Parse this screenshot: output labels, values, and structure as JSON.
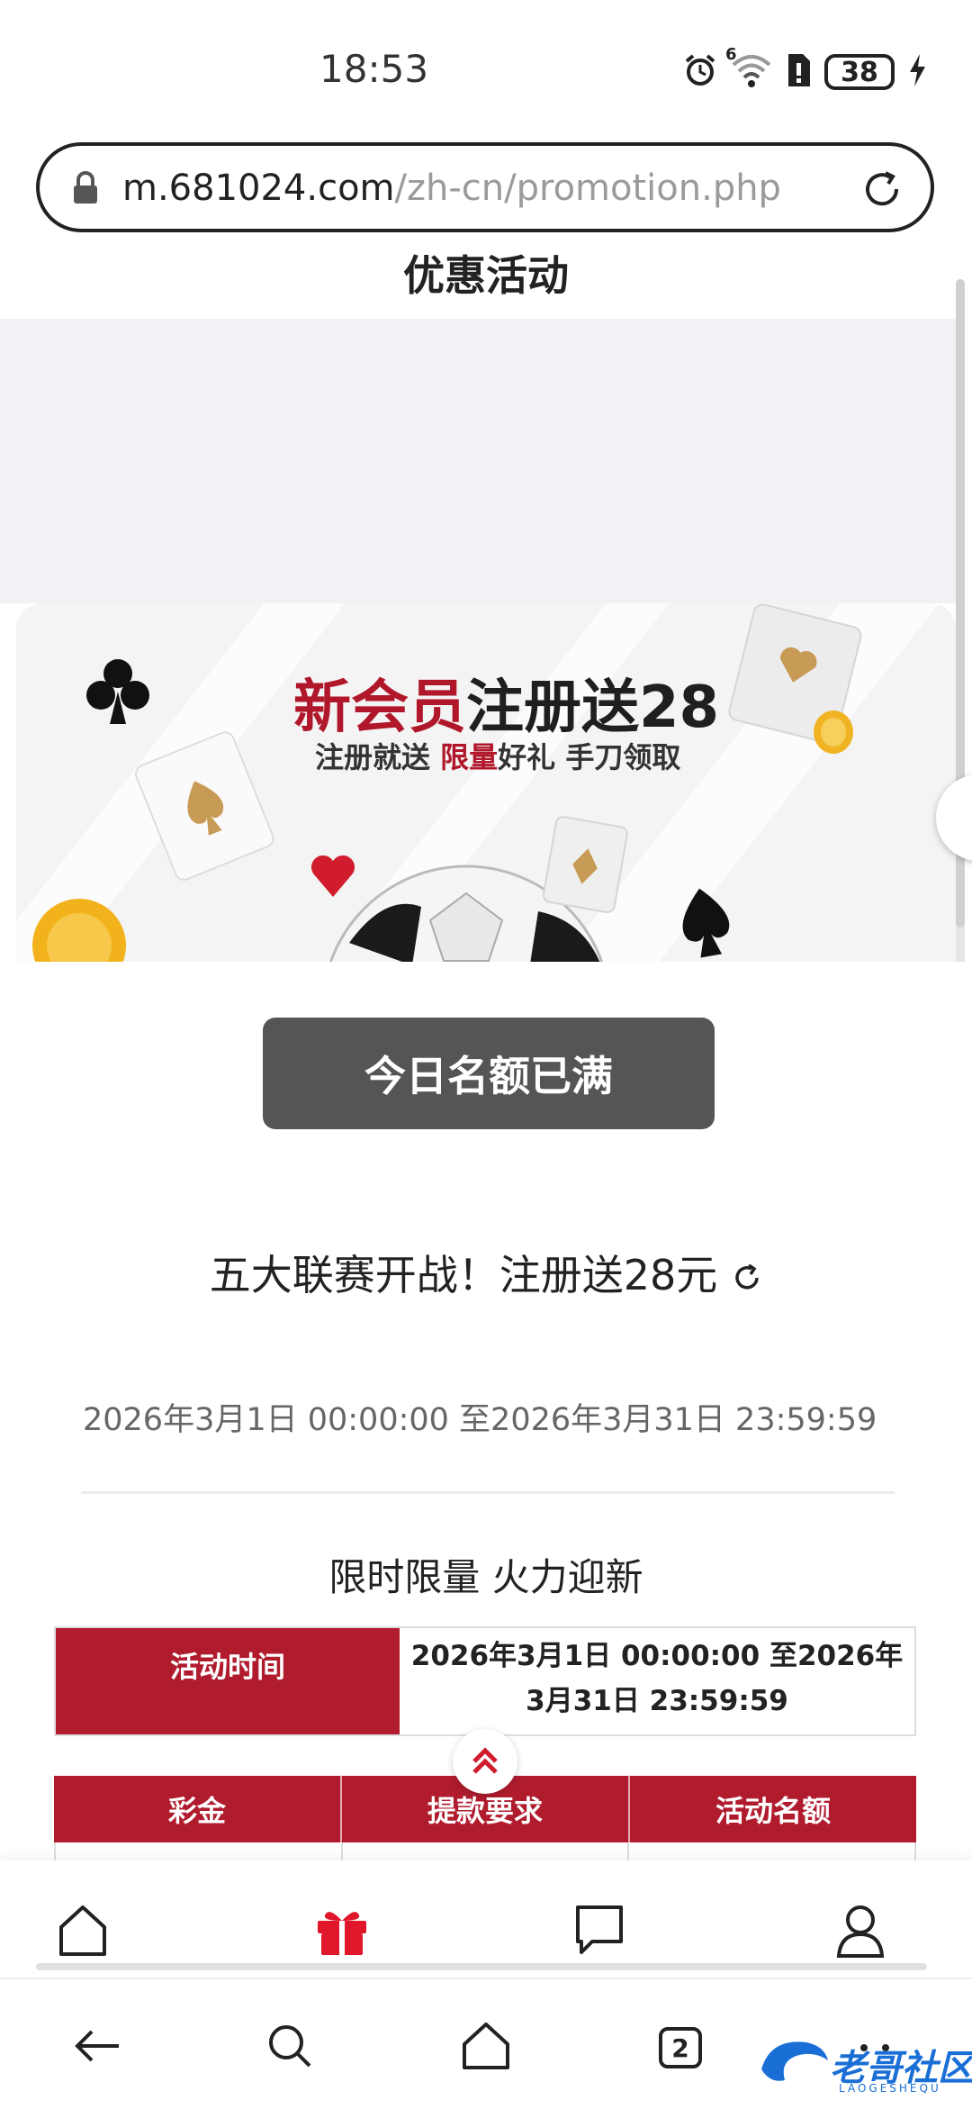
{
  "status_bar": {
    "time": "18:53",
    "battery": "38",
    "network_sup": "6"
  },
  "browser": {
    "url_host": "m.681024.com",
    "url_path": "/zh-cn/promotion.php",
    "tab_count": "2"
  },
  "page": {
    "title": "优惠活动"
  },
  "banner": {
    "title_red": "新会员",
    "title_rest": "注册送28",
    "sub_pre": "注册就送 ",
    "sub_red": "限量",
    "sub_post": "好礼 手刀领取"
  },
  "promotion": {
    "button_label": "今日名额已满",
    "title": "五大联赛开战！注册送28元",
    "date_range": "2026年3月1日 00:00:00 至2026年3月31日 23:59:59",
    "section_title": "限时限量 火力迎新",
    "time_label": "活动时间",
    "time_value": "2026年3月1日 00:00:00 至2026年3月31日 23:59:59",
    "table_headers": [
      "彩金",
      "提款要求",
      "活动名额"
    ]
  },
  "app_nav": {
    "items": [
      "home-icon",
      "gift-icon",
      "chat-icon",
      "profile-icon"
    ],
    "active": "gift-icon",
    "accent": "#e0162b"
  },
  "browser_nav": {
    "items": [
      "back-icon",
      "search-icon",
      "home-icon",
      "tabs-icon",
      "more-icon"
    ]
  },
  "watermark": {
    "text": "老哥社区",
    "sub": "LAOGESHEQU"
  },
  "colors": {
    "brand_red": "#b01c2e",
    "button_gray": "#555555",
    "page_bg": "#f2f2f6"
  }
}
